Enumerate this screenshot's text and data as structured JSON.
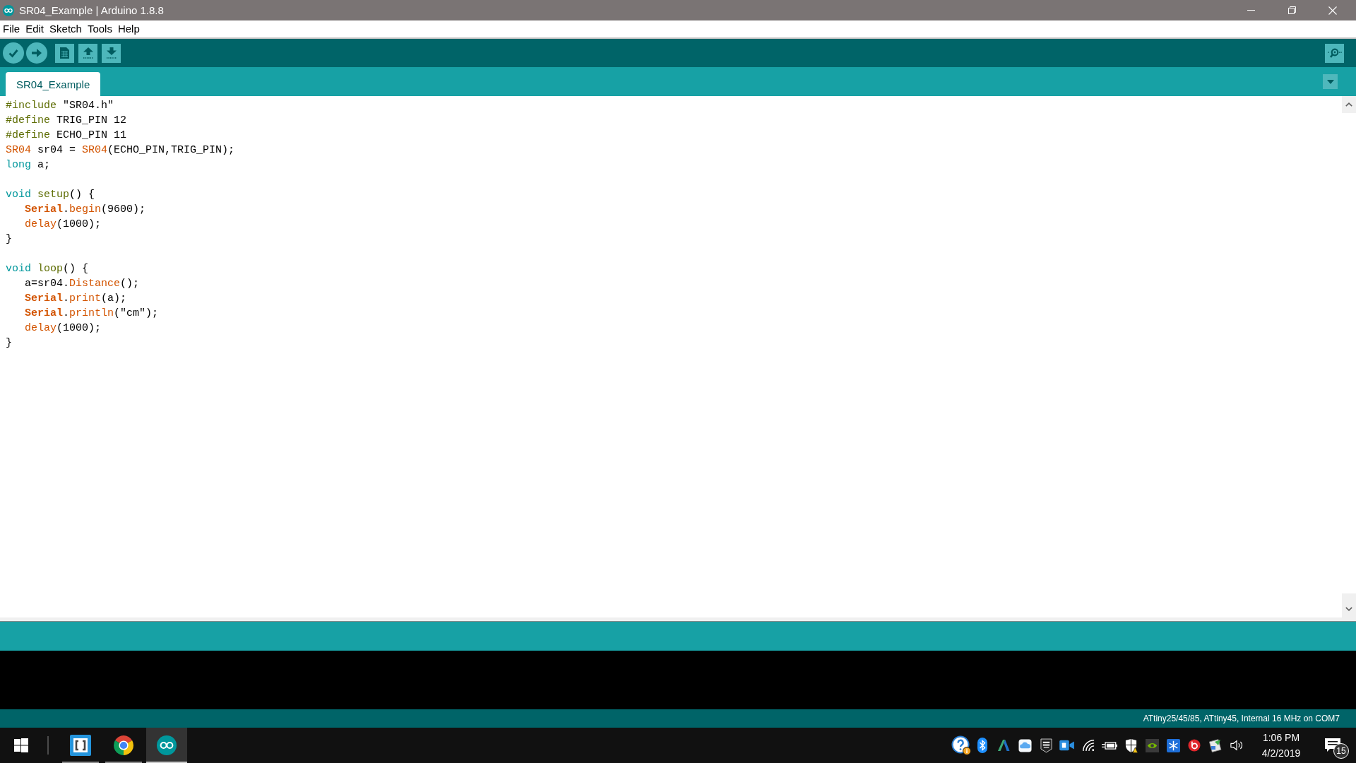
{
  "window": {
    "title": "SR04_Example | Arduino 1.8.8"
  },
  "menu": [
    "File",
    "Edit",
    "Sketch",
    "Tools",
    "Help"
  ],
  "tabs": [
    {
      "label": "SR04_Example",
      "selected": true
    }
  ],
  "code": [
    {
      "kind": "code",
      "tokens": [
        {
          "text": "#include",
          "kind": "preprocessor"
        },
        {
          "text": " \"SR04.h\"",
          "kind": "plain"
        }
      ]
    },
    {
      "kind": "code",
      "tokens": [
        {
          "text": "#define",
          "kind": "preprocessor"
        },
        {
          "text": " TRIG_PIN 12",
          "kind": "plain"
        }
      ]
    },
    {
      "kind": "code",
      "tokens": [
        {
          "text": "#define",
          "kind": "preprocessor"
        },
        {
          "text": " ECHO_PIN 11",
          "kind": "plain"
        }
      ]
    },
    {
      "kind": "code",
      "tokens": [
        {
          "text": "SR04",
          "kind": "library"
        },
        {
          "text": " sr04 = ",
          "kind": "plain"
        },
        {
          "text": "SR04",
          "kind": "library"
        },
        {
          "text": "(ECHO_PIN,TRIG_PIN);",
          "kind": "plain"
        }
      ]
    },
    {
      "kind": "code",
      "tokens": [
        {
          "text": "long",
          "kind": "datatype"
        },
        {
          "text": " a;",
          "kind": "plain"
        }
      ]
    },
    {
      "kind": "blank"
    },
    {
      "kind": "code",
      "tokens": [
        {
          "text": "void ",
          "kind": "datatype"
        },
        {
          "text": "setup",
          "kind": "structure"
        },
        {
          "text": "() {",
          "kind": "plain"
        }
      ],
      "children": [
        {
          "kind": "code",
          "tokens": [
            {
              "text": "Serial",
              "kind": "object"
            },
            {
              "text": ".",
              "kind": "plain"
            },
            {
              "text": "begin",
              "kind": "function"
            },
            {
              "text": "(9600);",
              "kind": "plain"
            }
          ]
        },
        {
          "kind": "code",
          "tokens": [
            {
              "text": "delay",
              "kind": "function"
            },
            {
              "text": "(1000);",
              "kind": "plain"
            }
          ]
        }
      ]
    },
    {
      "kind": "code",
      "tokens": [
        {
          "text": "}",
          "kind": "plain"
        }
      ]
    },
    {
      "kind": "blank"
    },
    {
      "kind": "code",
      "tokens": [
        {
          "text": "void ",
          "kind": "datatype"
        },
        {
          "text": "loop",
          "kind": "structure"
        },
        {
          "text": "() {",
          "kind": "plain"
        }
      ],
      "children": [
        {
          "kind": "code",
          "tokens": [
            {
              "text": "a=sr04.",
              "kind": "plain"
            },
            {
              "text": "Distance",
              "kind": "function"
            },
            {
              "text": "();",
              "kind": "plain"
            }
          ]
        },
        {
          "kind": "code",
          "tokens": [
            {
              "text": "Serial",
              "kind": "object"
            },
            {
              "text": ".",
              "kind": "plain"
            },
            {
              "text": "print",
              "kind": "function"
            },
            {
              "text": "(a);",
              "kind": "plain"
            }
          ]
        },
        {
          "kind": "code",
          "tokens": [
            {
              "text": "Serial",
              "kind": "object"
            },
            {
              "text": ".",
              "kind": "plain"
            },
            {
              "text": "println",
              "kind": "function"
            },
            {
              "text": "(\"cm\");",
              "kind": "plain"
            }
          ]
        },
        {
          "kind": "code",
          "tokens": [
            {
              "text": "delay",
              "kind": "function"
            },
            {
              "text": "(1000);",
              "kind": "plain"
            }
          ]
        }
      ]
    },
    {
      "kind": "code",
      "tokens": [
        {
          "text": "}",
          "kind": "plain"
        }
      ]
    }
  ],
  "status_bar": {
    "board": "ATtiny25/45/85, ATtiny45, Internal 16 MHz on COM7"
  },
  "taskbar": {
    "apps": [
      {
        "kind": "brackets",
        "selected": false
      },
      {
        "kind": "browser",
        "selected": false
      },
      {
        "kind": "arduino",
        "selected": true
      }
    ],
    "clock": {
      "time": "1:06 PM",
      "date": "4/2/2019"
    },
    "notifications": {
      "count": "15"
    }
  }
}
